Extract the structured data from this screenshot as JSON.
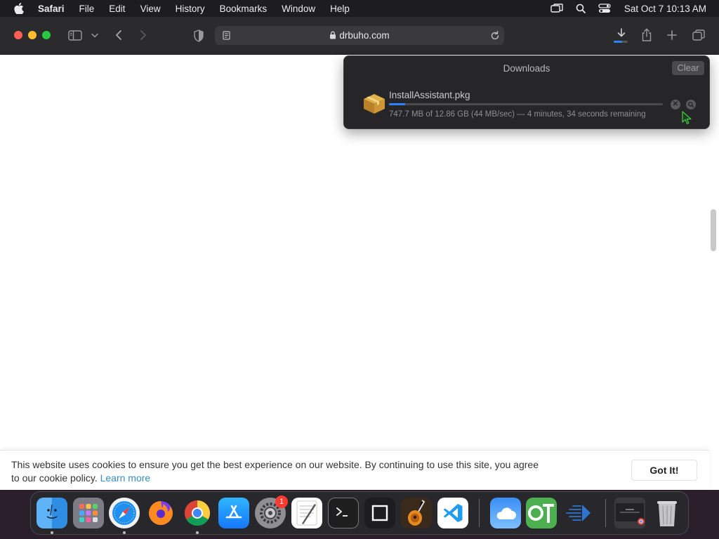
{
  "menubar": {
    "app_name": "Safari",
    "menus": [
      "File",
      "Edit",
      "View",
      "History",
      "Bookmarks",
      "Window",
      "Help"
    ],
    "clock": "Sat Oct 7  10:13 AM"
  },
  "toolbar": {
    "url": "drbuho.com",
    "download_progress": 0.06
  },
  "downloads": {
    "title": "Downloads",
    "clear_label": "Clear",
    "item": {
      "filename": "InstallAssistant.pkg",
      "status": "747.7 MB of 12.86 GB (44 MB/sec) — 4 minutes, 34 seconds remaining",
      "progress": 0.058
    }
  },
  "cookie_banner": {
    "message": "This website uses cookies to ensure you get the best experience on our website. By continuing to use this site, you agree to our cookie policy.",
    "learn_more": "Learn more",
    "button": "Got It!"
  },
  "dock": {
    "apps": [
      "finder",
      "launchpad",
      "safari",
      "firefox",
      "chrome",
      "app-store",
      "system-settings",
      "textedit",
      "terminal",
      "preview",
      "garageband",
      "vscode",
      "weather",
      "ot",
      "bluestacks",
      "chrome-window",
      "trash"
    ],
    "settings_badge": "1"
  },
  "colors": {
    "accent": "#2f82ff",
    "link": "#3a8ec4",
    "close": "#ff5f57",
    "minimize": "#febc2e",
    "zoom": "#28c840"
  }
}
